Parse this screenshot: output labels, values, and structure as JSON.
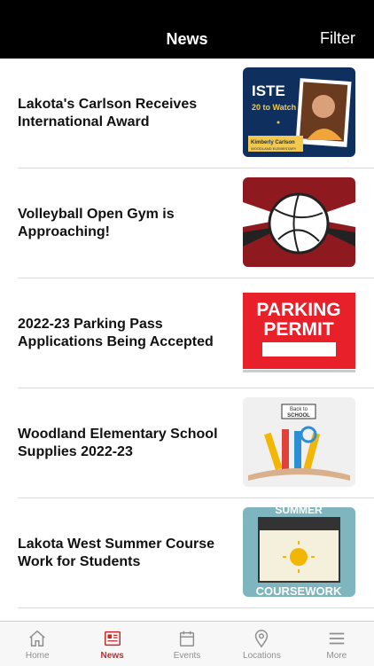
{
  "header": {
    "title": "News",
    "filter_label": "Filter"
  },
  "articles": [
    {
      "headline": "Lakota's Carlson Receives International Award",
      "thumb": {
        "badge": "ISTE",
        "sub": "20 to Watch",
        "caption": "Kimberly Carlson",
        "caption2": "WOODLAND ELEMENTARY"
      }
    },
    {
      "headline": "Volleyball Open Gym is Approaching!",
      "thumb": {}
    },
    {
      "headline": "2022-23 Parking Pass Applications Being Accepted",
      "thumb": {
        "line1": "PARKING",
        "line2": "PERMIT"
      }
    },
    {
      "headline": "Woodland Elementary School Supplies 2022-23",
      "thumb": {
        "sign1": "Back to",
        "sign2": "SCHOOL"
      }
    },
    {
      "headline": "Lakota West Summer Course Work for Students",
      "thumb": {
        "top": "SUMMER",
        "bottom": "COURSEWORK"
      }
    }
  ],
  "tabs": [
    {
      "label": "Home",
      "icon": "home-icon"
    },
    {
      "label": "News",
      "icon": "news-icon",
      "active": true
    },
    {
      "label": "Events",
      "icon": "calendar-icon"
    },
    {
      "label": "Locations",
      "icon": "location-pin-icon"
    },
    {
      "label": "More",
      "icon": "menu-icon"
    }
  ],
  "colors": {
    "accent": "#c62828",
    "header_bg": "#000000"
  }
}
